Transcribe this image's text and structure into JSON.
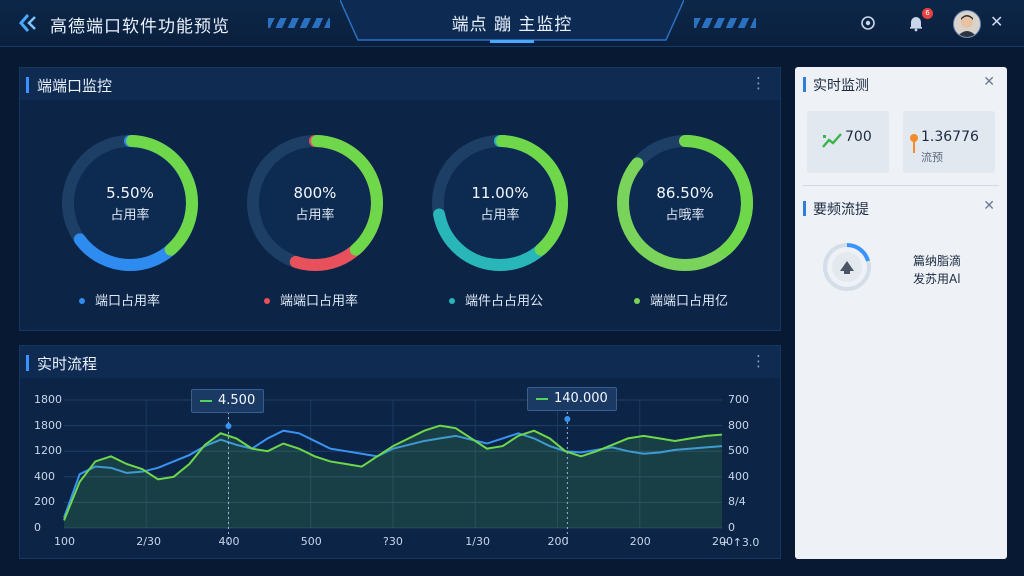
{
  "header": {
    "app_title": "高德端口软件功能预览",
    "center_title": "端点  蹦  主监控",
    "notification_count": "6"
  },
  "port_panel": {
    "title": "端端口监控",
    "gauges": [
      {
        "value_text": "5.50%",
        "label": "占用率",
        "legend": "端口占用率",
        "color": "#2e8cf0",
        "fill": 0.65
      },
      {
        "value_text": "800%",
        "label": "占用率",
        "legend": "端端口占用率",
        "color": "#e8505b",
        "fill": 0.55
      },
      {
        "value_text": "11.00%",
        "label": "占用率",
        "legend": "端件占占用公",
        "color": "#28b6b8",
        "fill": 0.72
      },
      {
        "value_text": "86.50%",
        "label": "占哦率",
        "legend": "端端口占用亿",
        "color": "#7ad35a",
        "fill": 0.86
      }
    ]
  },
  "flow_panel": {
    "title": "实时流程",
    "tooltips": [
      "4.500",
      "140.000"
    ]
  },
  "side_panel": {
    "monitor_title": "实时监测",
    "card1": {
      "value": "700"
    },
    "card2": {
      "value": "1.36776",
      "sub": "流预"
    },
    "flow_title": "要频流提",
    "info_line1": "篇纳脂滴",
    "info_line2": "发苏用Al"
  },
  "chart_data": {
    "type": "line",
    "x_ticks": [
      "100",
      "2/30",
      "400",
      "500",
      "?30",
      "1/30",
      "200",
      "200",
      "200"
    ],
    "x_unit": "+ ↑3.0",
    "y_left_ticks": [
      "1800",
      "1800",
      "1200",
      "400",
      "200",
      "0"
    ],
    "y_right_ticks": [
      "700",
      "800",
      "500",
      "400",
      "8/4",
      "0"
    ],
    "ylim": [
      0,
      1000
    ],
    "series": [
      {
        "color": "#3a93f0",
        "values": [
          80,
          420,
          480,
          470,
          430,
          440,
          470,
          520,
          570,
          640,
          690,
          650,
          620,
          700,
          760,
          740,
          680,
          620,
          600,
          580,
          560,
          620,
          650,
          680,
          700,
          720,
          690,
          660,
          700,
          740,
          700,
          640,
          600,
          590,
          610,
          630,
          600,
          580,
          590,
          610,
          620,
          630,
          640
        ]
      },
      {
        "color": "#6fd84a",
        "values": [
          60,
          360,
          520,
          560,
          500,
          460,
          380,
          400,
          500,
          650,
          740,
          700,
          620,
          600,
          660,
          620,
          560,
          520,
          500,
          480,
          560,
          640,
          700,
          760,
          800,
          780,
          700,
          620,
          640,
          720,
          760,
          700,
          600,
          560,
          600,
          650,
          700,
          720,
          700,
          680,
          700,
          720,
          730
        ]
      }
    ]
  }
}
